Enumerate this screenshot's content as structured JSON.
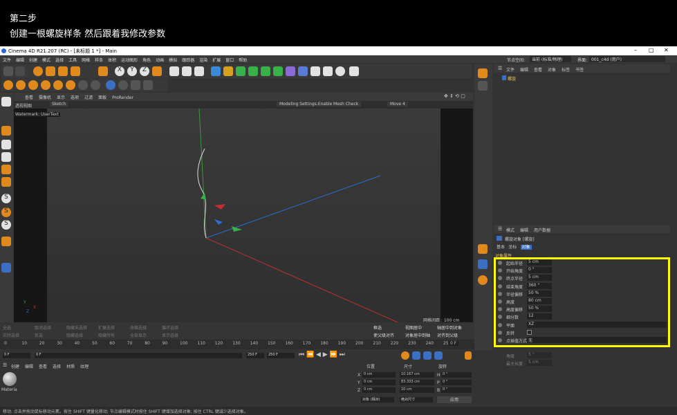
{
  "caption": {
    "line1": "第二步",
    "line2": "创建一根螺旋样条 然后跟着我修改参数"
  },
  "app": {
    "title": "Cinema 4D R21.207 (RC) - [未标题 1 *] - Main"
  },
  "menu": [
    "文件",
    "编辑",
    "创建",
    "模式",
    "选择",
    "工具",
    "网格",
    "样条",
    "体积",
    "运动图形",
    "角色",
    "动画",
    "模拟",
    "跟踪器",
    "渲染",
    "扩展",
    "窗口",
    "帮助"
  ],
  "layout_bar": {
    "node_label": "节点空间:",
    "node_value": "当前 (标准/物理)",
    "layout_label": "界面:",
    "layout_value": "001_c4d (用户)"
  },
  "viewport": {
    "menus": [
      "查看",
      "摄像机",
      "显示",
      "选项",
      "过滤",
      "面板",
      "ProRender"
    ],
    "tab": "透视视图",
    "sketch": "Sketch",
    "hint": "Modeling Settings.Enable Mesh Check",
    "move": "Move 4",
    "watermark": "Watermark: UserText",
    "grid": "网格间距 : 100 cm",
    "axis_y": "Y",
    "axis_x": "X",
    "axis_z": "Z"
  },
  "object_manager": {
    "menus": [
      "文件",
      "编辑",
      "查看",
      "对象",
      "标签",
      "书签"
    ],
    "object": "螺旋"
  },
  "attributes": {
    "menus": [
      "模式",
      "编辑",
      "用户数据"
    ],
    "title": "螺旋对象 [螺旋]",
    "tabs": [
      "基本",
      "坐标",
      "对象"
    ],
    "section": "对象属性",
    "params": [
      {
        "label": "起始半径",
        "value": "5 cm"
      },
      {
        "label": "开始角度",
        "value": "0 °"
      },
      {
        "label": "终点半径",
        "value": "5 cm"
      },
      {
        "label": "结束角度",
        "value": "360 °"
      },
      {
        "label": "半径偏移",
        "value": "50 %"
      },
      {
        "label": "高度",
        "value": "80 cm"
      },
      {
        "label": "高度偏移",
        "value": "50 %"
      },
      {
        "label": "细分数",
        "value": "12"
      },
      {
        "label": "平面",
        "value": "XZ"
      },
      {
        "label": "反转",
        "value": ""
      },
      {
        "label": "点插值方式",
        "value": "无"
      }
    ],
    "extra": [
      {
        "label": "角度",
        "value": "5 °"
      },
      {
        "label": "最大长度",
        "value": "5 cm"
      }
    ]
  },
  "bottom_tools": [
    "全选",
    "取消选择",
    "隐藏未选择",
    "扩展选择",
    "收缩选择",
    "循环选择",
    "实时选择",
    "反选",
    "隐藏选择",
    "隐藏所有",
    "全部显示",
    "显示选择",
    "框选",
    "视图居中",
    "轴居中到对象",
    "使父级对齐",
    "对象居中到轴",
    "对齐到父级"
  ],
  "timeline": {
    "ticks": [
      "0",
      "10",
      "20",
      "30",
      "40",
      "50",
      "60",
      "70",
      "80",
      "90",
      "100",
      "110",
      "120",
      "130",
      "140",
      "150",
      "160",
      "170",
      "180",
      "190",
      "200",
      "210",
      "220",
      "230",
      "240",
      "250"
    ],
    "frame": "0 F"
  },
  "transport": {
    "start": "0 F",
    "current": "0 F",
    "end": "250 F",
    "end2": "250 F"
  },
  "materials": {
    "menus": [
      "创建",
      "编辑",
      "查看",
      "选择",
      "材质",
      "纹理"
    ],
    "item": "Materia"
  },
  "coords": {
    "headers": [
      "位置",
      "尺寸",
      "旋转"
    ],
    "rows": [
      {
        "axis": "X",
        "pos": "0 cm",
        "size": "10.167 cm",
        "rot_axis": "H",
        "rot": "0 °"
      },
      {
        "axis": "Y",
        "pos": "0 cm",
        "size": "83.333 cm",
        "rot_axis": "P",
        "rot": "0 °"
      },
      {
        "axis": "Z",
        "pos": "0 cm",
        "size": "10 cm",
        "rot_axis": "B",
        "rot": "0 °"
      }
    ],
    "mode1": "对象 (相对)",
    "mode2": "绝对尺寸",
    "apply": "应用"
  },
  "status": "移动: 点击并拖动鼠标移动元素。按住 SHIFT 键量化移动; 节点编辑模式时按住 SHIFT 键增加选择对象; 按住 CTRL 键减少选择对象。"
}
